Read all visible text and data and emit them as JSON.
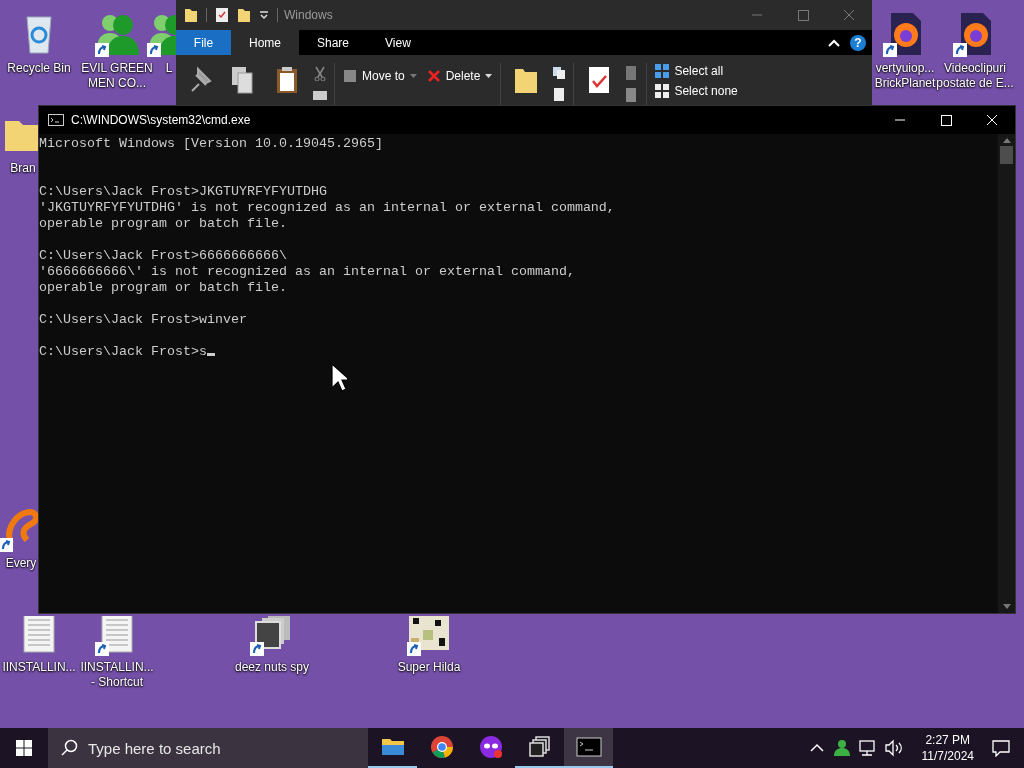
{
  "desktop_icons": [
    {
      "label": [
        "Recycle Bin"
      ],
      "kind": "recycle",
      "shortcut": false
    },
    {
      "label": [
        "EVIL GREEN",
        "MEN CO..."
      ],
      "kind": "people",
      "shortcut": true
    },
    {
      "label": [
        "L"
      ],
      "kind": "people",
      "shortcut": true
    },
    {
      "label": [
        "vertyuiop...",
        "BrickPlanet"
      ],
      "kind": "firefox",
      "shortcut": true
    },
    {
      "label": [
        "Videoclipuri",
        "postate de E..."
      ],
      "kind": "firefox",
      "shortcut": true
    },
    {
      "label": [
        "Bran"
      ],
      "kind": "folder",
      "shortcut": false
    },
    {
      "label": [
        "Every"
      ],
      "kind": "swirl",
      "shortcut": true
    },
    {
      "label": [
        "IINSTALLIN..."
      ],
      "kind": "document",
      "shortcut": false
    },
    {
      "label": [
        "IINSTALLIN...",
        "- Shortcut"
      ],
      "kind": "document",
      "shortcut": true
    },
    {
      "label": [
        "deez nuts spy"
      ],
      "kind": "windows",
      "shortcut": true
    },
    {
      "label": [
        "Super Hilda"
      ],
      "kind": "pixel",
      "shortcut": true
    }
  ],
  "explorer": {
    "title": "Windows",
    "file_menu": "File",
    "tabs": [
      {
        "label": "Home",
        "selected": true
      },
      {
        "label": "Share",
        "selected": false
      },
      {
        "label": "View",
        "selected": false
      }
    ],
    "help": "?",
    "ribbon": [
      {
        "kind": "pin"
      },
      {
        "kind": "copy"
      },
      {
        "kind": "paste"
      },
      {
        "kind": "cutstack"
      },
      {
        "kind": "separator"
      },
      {
        "kind": "moveto",
        "label": "Move to",
        "dropdown": true
      },
      {
        "kind": "delete",
        "label": "Delete",
        "dropdown": true
      },
      {
        "kind": "separator"
      },
      {
        "kind": "newfolder"
      },
      {
        "kind": "newstack"
      },
      {
        "kind": "separator"
      },
      {
        "kind": "properties"
      },
      {
        "kind": "openstack"
      },
      {
        "kind": "separator"
      },
      {
        "kind": "selection",
        "items": [
          {
            "label": "Select all"
          },
          {
            "label": "Select none"
          }
        ]
      }
    ]
  },
  "cmd": {
    "title": "C:\\WINDOWS\\system32\\cmd.exe",
    "cursor": true,
    "blocks": [
      [
        "Microsoft Windows [Version 10.0.19045.2965]"
      ],
      [
        "C:\\Users\\Jack Frost>JKGTUYRFYFYUTDHG",
        "'JKGTUYRFYFYUTDHG' is not recognized as an internal or external command,",
        "operable program or batch file."
      ],
      [
        "C:\\Users\\Jack Frost>6666666666\\",
        "'6666666666\\' is not recognized as an internal or external command,",
        "operable program or batch file."
      ],
      [
        "C:\\Users\\Jack Frost>winver"
      ],
      [
        "C:\\Users\\Jack Frost>s"
      ]
    ]
  },
  "taskbar": {
    "search": {
      "placeholder": "Type here to search"
    },
    "apps": [
      {
        "kind": "explorer",
        "running": true,
        "selected": false
      },
      {
        "kind": "chrome",
        "running": false,
        "selected": false
      },
      {
        "kind": "mask",
        "running": false,
        "selected": false
      },
      {
        "kind": "stack",
        "running": true,
        "selected": false
      },
      {
        "kind": "console",
        "running": true,
        "selected": true
      }
    ],
    "time": "2:27 PM",
    "date": "11/7/2024"
  }
}
